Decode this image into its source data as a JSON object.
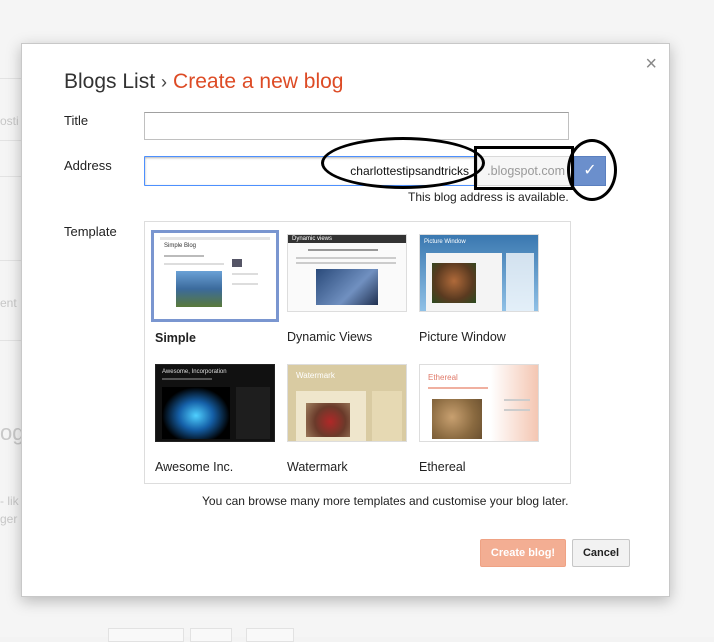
{
  "background": {
    "left_fragments": [
      "osti",
      "ent",
      "- lik",
      "ger"
    ],
    "big_fragment": "og"
  },
  "dialog": {
    "close_glyph": "×",
    "breadcrumb": {
      "parent": "Blogs List",
      "separator": "›",
      "current": "Create a new blog"
    },
    "title_label": "Title",
    "title_value": "",
    "address_label": "Address",
    "address_value": "charlottestipsandtricks",
    "address_domain": ".blogspot.com",
    "check_glyph": "✓",
    "availability": "This blog address is available.",
    "template_label": "Template",
    "templates": [
      {
        "name": "Simple",
        "thumb_title": "Simple Blog"
      },
      {
        "name": "Dynamic Views",
        "thumb_title": "Dynamic views"
      },
      {
        "name": "Picture Window",
        "thumb_title": "Picture Window"
      },
      {
        "name": "Awesome Inc.",
        "thumb_title": "Awesome, Incorporation"
      },
      {
        "name": "Watermark",
        "thumb_title": "Watermark"
      },
      {
        "name": "Ethereal",
        "thumb_title": "Ethereal"
      }
    ],
    "browse_note": "You can browse many more templates and customise your blog later.",
    "create_label": "Create blog!",
    "cancel_label": "Cancel"
  },
  "colors": {
    "accent": "#dd4b25",
    "focus_border": "#4d90fe",
    "check_button": "#6b8fcc",
    "create_button": "#f3ae93"
  }
}
